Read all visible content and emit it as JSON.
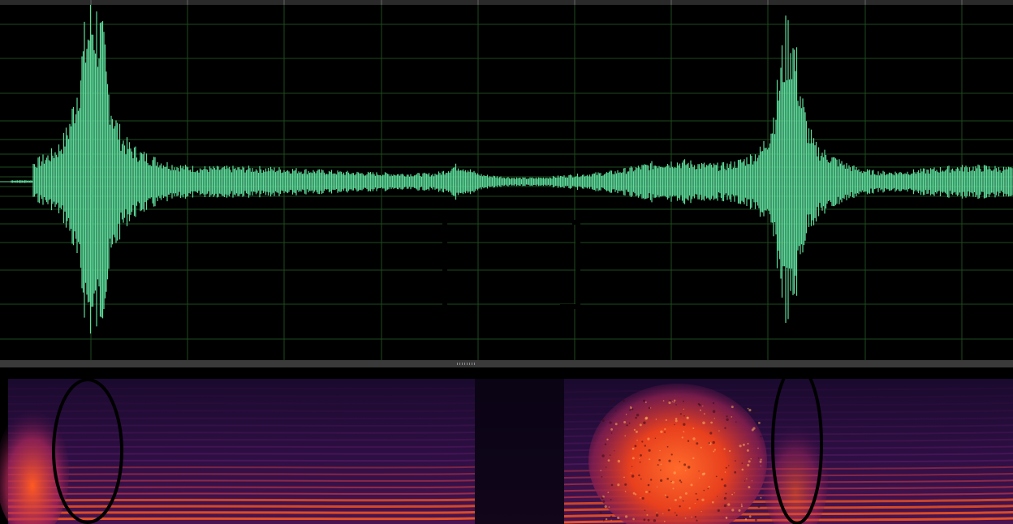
{
  "colors": {
    "background": "#000000",
    "grid": "#1e4a1e",
    "waveform": "#5ddb9a",
    "divider": "#3a3a3a",
    "spectrogram_low": "#1a0830",
    "spectrogram_mid": "#6a1e6e",
    "spectrogram_high": "#ff5a1e",
    "spectrogram_peak": "#ffb060",
    "annotation": "#000000"
  },
  "waveform_view": {
    "icon": "waveform-icon"
  },
  "spectrogram_view": {
    "icon": "spectrogram-icon"
  },
  "divider": {
    "icon": "resize-grip-icon"
  }
}
